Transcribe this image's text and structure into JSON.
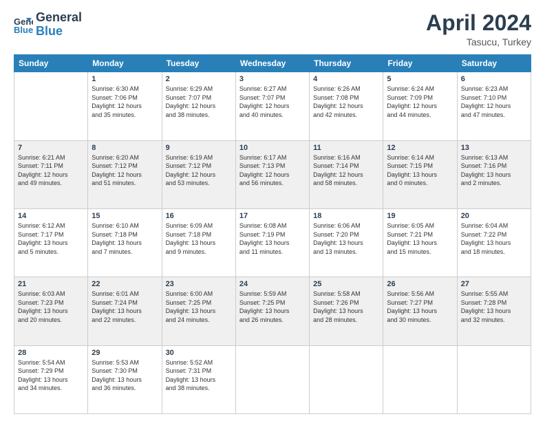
{
  "logo": {
    "line1": "General",
    "line2": "Blue"
  },
  "header": {
    "month_year": "April 2024",
    "location": "Tasucu, Turkey"
  },
  "weekdays": [
    "Sunday",
    "Monday",
    "Tuesday",
    "Wednesday",
    "Thursday",
    "Friday",
    "Saturday"
  ],
  "weeks": [
    [
      {
        "day": "",
        "info": ""
      },
      {
        "day": "1",
        "info": "Sunrise: 6:30 AM\nSunset: 7:06 PM\nDaylight: 12 hours\nand 35 minutes."
      },
      {
        "day": "2",
        "info": "Sunrise: 6:29 AM\nSunset: 7:07 PM\nDaylight: 12 hours\nand 38 minutes."
      },
      {
        "day": "3",
        "info": "Sunrise: 6:27 AM\nSunset: 7:07 PM\nDaylight: 12 hours\nand 40 minutes."
      },
      {
        "day": "4",
        "info": "Sunrise: 6:26 AM\nSunset: 7:08 PM\nDaylight: 12 hours\nand 42 minutes."
      },
      {
        "day": "5",
        "info": "Sunrise: 6:24 AM\nSunset: 7:09 PM\nDaylight: 12 hours\nand 44 minutes."
      },
      {
        "day": "6",
        "info": "Sunrise: 6:23 AM\nSunset: 7:10 PM\nDaylight: 12 hours\nand 47 minutes."
      }
    ],
    [
      {
        "day": "7",
        "info": "Sunrise: 6:21 AM\nSunset: 7:11 PM\nDaylight: 12 hours\nand 49 minutes."
      },
      {
        "day": "8",
        "info": "Sunrise: 6:20 AM\nSunset: 7:12 PM\nDaylight: 12 hours\nand 51 minutes."
      },
      {
        "day": "9",
        "info": "Sunrise: 6:19 AM\nSunset: 7:12 PM\nDaylight: 12 hours\nand 53 minutes."
      },
      {
        "day": "10",
        "info": "Sunrise: 6:17 AM\nSunset: 7:13 PM\nDaylight: 12 hours\nand 56 minutes."
      },
      {
        "day": "11",
        "info": "Sunrise: 6:16 AM\nSunset: 7:14 PM\nDaylight: 12 hours\nand 58 minutes."
      },
      {
        "day": "12",
        "info": "Sunrise: 6:14 AM\nSunset: 7:15 PM\nDaylight: 13 hours\nand 0 minutes."
      },
      {
        "day": "13",
        "info": "Sunrise: 6:13 AM\nSunset: 7:16 PM\nDaylight: 13 hours\nand 2 minutes."
      }
    ],
    [
      {
        "day": "14",
        "info": "Sunrise: 6:12 AM\nSunset: 7:17 PM\nDaylight: 13 hours\nand 5 minutes."
      },
      {
        "day": "15",
        "info": "Sunrise: 6:10 AM\nSunset: 7:18 PM\nDaylight: 13 hours\nand 7 minutes."
      },
      {
        "day": "16",
        "info": "Sunrise: 6:09 AM\nSunset: 7:18 PM\nDaylight: 13 hours\nand 9 minutes."
      },
      {
        "day": "17",
        "info": "Sunrise: 6:08 AM\nSunset: 7:19 PM\nDaylight: 13 hours\nand 11 minutes."
      },
      {
        "day": "18",
        "info": "Sunrise: 6:06 AM\nSunset: 7:20 PM\nDaylight: 13 hours\nand 13 minutes."
      },
      {
        "day": "19",
        "info": "Sunrise: 6:05 AM\nSunset: 7:21 PM\nDaylight: 13 hours\nand 15 minutes."
      },
      {
        "day": "20",
        "info": "Sunrise: 6:04 AM\nSunset: 7:22 PM\nDaylight: 13 hours\nand 18 minutes."
      }
    ],
    [
      {
        "day": "21",
        "info": "Sunrise: 6:03 AM\nSunset: 7:23 PM\nDaylight: 13 hours\nand 20 minutes."
      },
      {
        "day": "22",
        "info": "Sunrise: 6:01 AM\nSunset: 7:24 PM\nDaylight: 13 hours\nand 22 minutes."
      },
      {
        "day": "23",
        "info": "Sunrise: 6:00 AM\nSunset: 7:25 PM\nDaylight: 13 hours\nand 24 minutes."
      },
      {
        "day": "24",
        "info": "Sunrise: 5:59 AM\nSunset: 7:25 PM\nDaylight: 13 hours\nand 26 minutes."
      },
      {
        "day": "25",
        "info": "Sunrise: 5:58 AM\nSunset: 7:26 PM\nDaylight: 13 hours\nand 28 minutes."
      },
      {
        "day": "26",
        "info": "Sunrise: 5:56 AM\nSunset: 7:27 PM\nDaylight: 13 hours\nand 30 minutes."
      },
      {
        "day": "27",
        "info": "Sunrise: 5:55 AM\nSunset: 7:28 PM\nDaylight: 13 hours\nand 32 minutes."
      }
    ],
    [
      {
        "day": "28",
        "info": "Sunrise: 5:54 AM\nSunset: 7:29 PM\nDaylight: 13 hours\nand 34 minutes."
      },
      {
        "day": "29",
        "info": "Sunrise: 5:53 AM\nSunset: 7:30 PM\nDaylight: 13 hours\nand 36 minutes."
      },
      {
        "day": "30",
        "info": "Sunrise: 5:52 AM\nSunset: 7:31 PM\nDaylight: 13 hours\nand 38 minutes."
      },
      {
        "day": "",
        "info": ""
      },
      {
        "day": "",
        "info": ""
      },
      {
        "day": "",
        "info": ""
      },
      {
        "day": "",
        "info": ""
      }
    ]
  ]
}
